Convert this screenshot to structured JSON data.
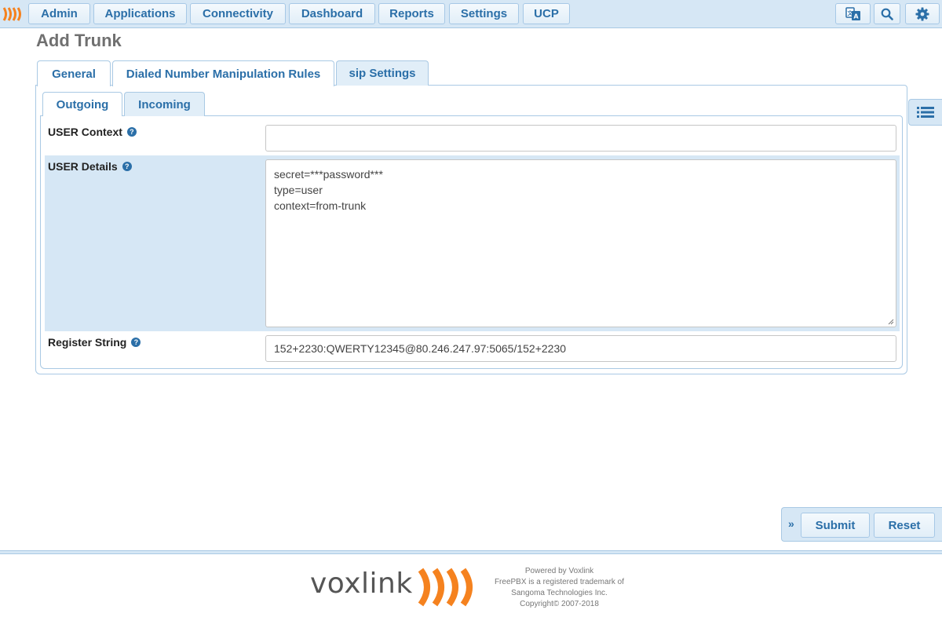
{
  "nav": {
    "items": [
      {
        "label": "Admin"
      },
      {
        "label": "Applications"
      },
      {
        "label": "Connectivity"
      },
      {
        "label": "Dashboard"
      },
      {
        "label": "Reports"
      },
      {
        "label": "Settings"
      },
      {
        "label": "UCP"
      }
    ],
    "icons": [
      "language-icon",
      "search-icon",
      "gear-icon"
    ]
  },
  "page": {
    "title": "Add Trunk"
  },
  "tabs": [
    {
      "label": "General",
      "active": false
    },
    {
      "label": "Dialed Number Manipulation Rules",
      "active": false
    },
    {
      "label": "sip Settings",
      "active": true
    }
  ],
  "subtabs": [
    {
      "label": "Outgoing",
      "active": false
    },
    {
      "label": "Incoming",
      "active": true
    }
  ],
  "form": {
    "user_context": {
      "label": "USER Context",
      "value": ""
    },
    "user_details": {
      "label": "USER Details",
      "lines": [
        "secret=***password***",
        "type=user",
        "context=from-trunk"
      ]
    },
    "register_string": {
      "label": "Register String",
      "value": "152+2230:QWERTY12345@80.246.247.97:5065/152+2230"
    }
  },
  "actions": {
    "submit": "Submit",
    "reset": "Reset"
  },
  "footer": {
    "brand": "voxlink",
    "lines": [
      "Powered by Voxlink",
      "FreePBX is a registered trademark of",
      "Sangoma Technologies Inc.",
      "Copyright© 2007-2018"
    ]
  },
  "colors": {
    "accent": "#2b6fa8",
    "bar_bg": "#d6e7f5",
    "border": "#a9c9e4",
    "brand_orange": "#f5821f"
  }
}
